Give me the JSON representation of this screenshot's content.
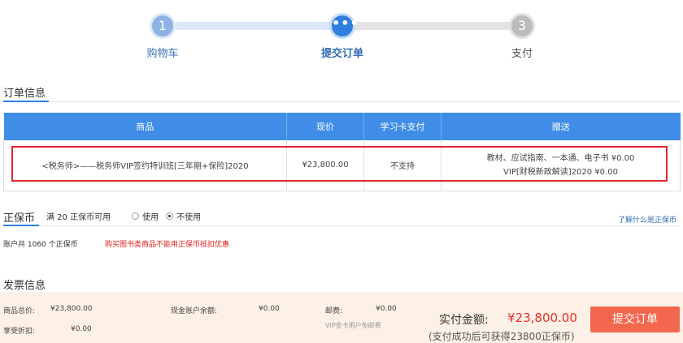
{
  "stepper": {
    "steps": [
      {
        "number": "1",
        "label": "购物车"
      },
      {
        "number": "•••",
        "label": "提交订单"
      },
      {
        "number": "3",
        "label": "支付"
      }
    ]
  },
  "order_info": {
    "title": "订单信息",
    "columns": [
      "商品",
      "现价",
      "学习卡支付",
      "赠送"
    ],
    "row": {
      "product": "<税务师>——税务师VIP签约特训班[三年期+保险]2020",
      "price": "¥23,800.00",
      "card_pay": "不支持",
      "gift_line1": "教材、应试指南、一本通、电子书 ¥0.00",
      "gift_line2": "VIP[财税新政解读]2020 ¥0.00"
    }
  },
  "coin": {
    "title": "正保币",
    "available": "满 20 正保币可用",
    "option_use": "使用",
    "option_not_use": "不使用",
    "selected": "不使用",
    "help_link": "了解什么是正保币",
    "account_text": "账户共 1060 个正保币",
    "warning": "购买图书类商品不能用正保币抵扣优惠"
  },
  "invoice": {
    "title": "发票信息"
  },
  "summary": {
    "total_label": "商品总价:",
    "total_value": "¥23,800.00",
    "discount_label": "享受折扣:",
    "discount_value": "¥0.00",
    "balance_label": "现金账户余额:",
    "balance_value": "¥0.00",
    "postage_label": "邮费:",
    "postage_value": "¥0.00",
    "postage_note": "VIP金卡用户免邮费",
    "pay_label": "实付金额:",
    "pay_value": "¥23,800.00",
    "pay_note": "(支付成功后可获得23800正保币)",
    "submit": "提交订单"
  },
  "colors": {
    "accent": "#2f7fe0",
    "header_blue": "#3f8de6",
    "highlight_red": "#e2262b",
    "price_red": "#e6312b",
    "submit_orange": "#f2674d",
    "summary_bg": "#fdf0e6"
  }
}
